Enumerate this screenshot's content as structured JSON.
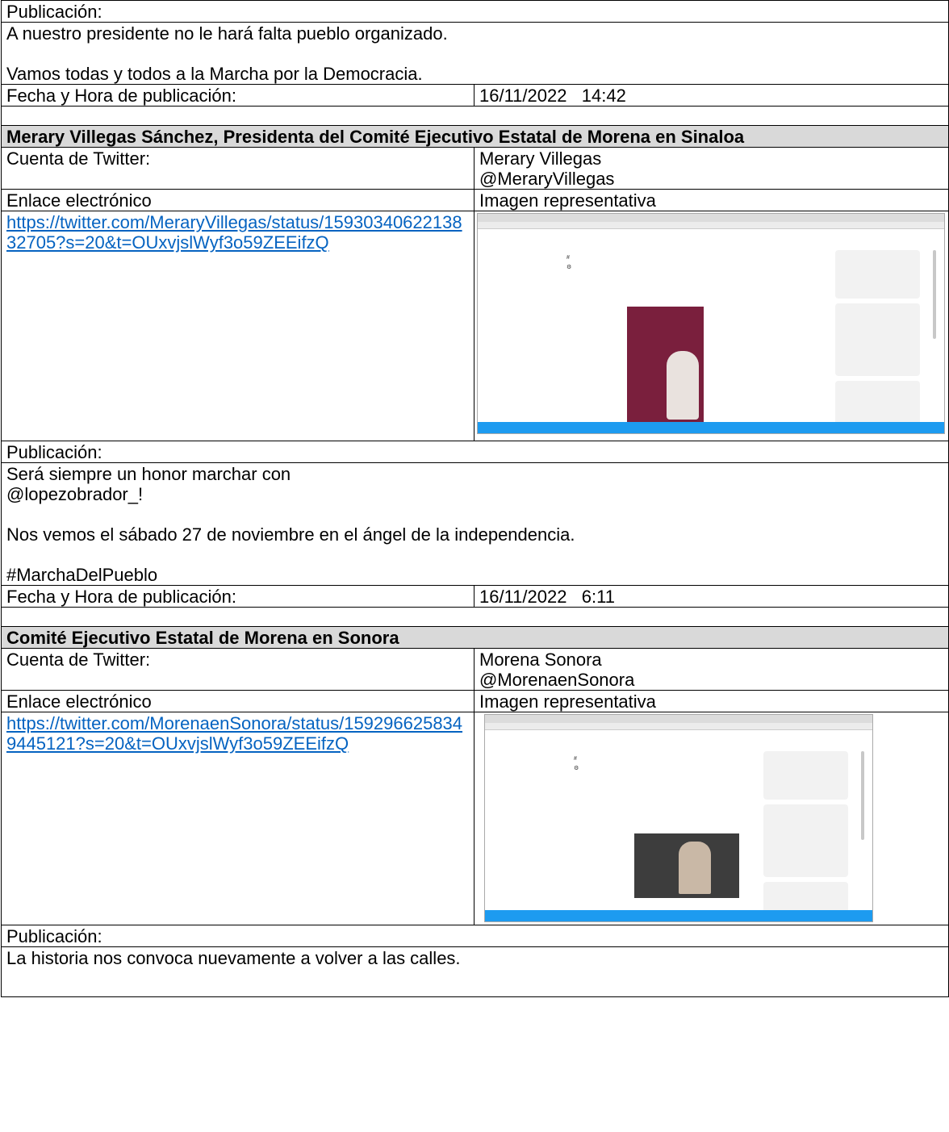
{
  "entries": [
    {
      "publication_label": "Publicación:",
      "publication_lines": [
        "A nuestro presidente no le hará falta pueblo organizado.",
        "",
        "Vamos todas y todos a la Marcha por la Democracia."
      ],
      "date_label": "Fecha y Hora de publicación:",
      "date_value": "16/11/2022   14:42"
    },
    {
      "header": "Merary Villegas Sánchez, Presidenta del Comité Ejecutivo Estatal de Morena en Sinaloa",
      "account_label": "Cuenta de Twitter:",
      "account_name": "Merary Villegas",
      "account_handle": "@MeraryVillegas",
      "link_label": "Enlace electrónico",
      "image_label": "Imagen representativa",
      "link_url": "https://twitter.com/MeraryVillegas/status/1593034062213832705?s=20&t=OUxvjslWyf3o59ZEEifzQ",
      "publication_label": "Publicación:",
      "publication_lines": [
        "Será siempre un honor marchar con",
        "@lopezobrador_!",
        "",
        "Nos vemos el sábado 27 de noviembre en el ángel de la independencia.",
        "",
        "#MarchaDelPueblo"
      ],
      "date_label": "Fecha y Hora de publicación:",
      "date_value": "16/11/2022   6:11"
    },
    {
      "header": "Comité Ejecutivo Estatal de Morena en Sonora",
      "account_label": "Cuenta de Twitter:",
      "account_name": "Morena Sonora",
      "account_handle": "@MorenaenSonora",
      "link_label": "Enlace electrónico",
      "image_label": "Imagen representativa",
      "link_url": "https://twitter.com/MorenaenSonora/status/1592966258349445121?s=20&t=OUxvjslWyf3o59ZEEifzQ",
      "publication_label": "Publicación:",
      "publication_lines": [
        "La historia nos convoca nuevamente a volver a las calles."
      ]
    }
  ]
}
